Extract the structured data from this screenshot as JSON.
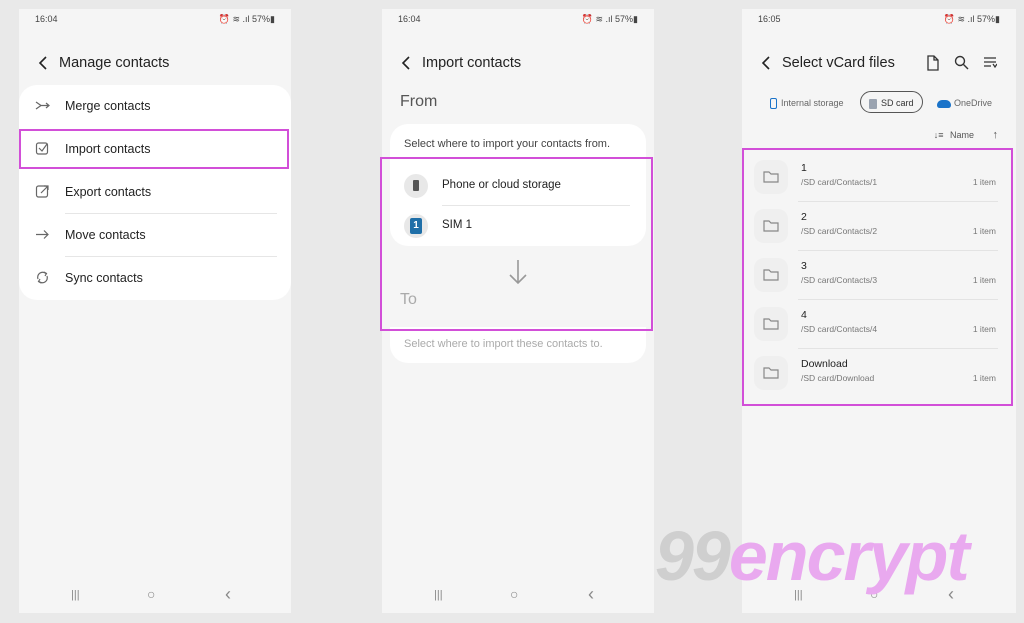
{
  "phone1": {
    "time": "16:04",
    "status_icons": "⏰ ≋ .ıl 57%▮",
    "title": "Manage contacts",
    "items": [
      {
        "label": "Merge contacts",
        "icon": "merge-icon"
      },
      {
        "label": "Import contacts",
        "icon": "import-icon"
      },
      {
        "label": "Export contacts",
        "icon": "export-icon"
      },
      {
        "label": "Move contacts",
        "icon": "move-arrow-icon"
      },
      {
        "label": "Sync contacts",
        "icon": "sync-icon"
      }
    ]
  },
  "phone2": {
    "time": "16:04",
    "status_icons": "⏰ ≋ .ıl 57%▮",
    "title": "Import contacts",
    "from_label": "From",
    "from_caption": "Select where to import your contacts from.",
    "sources": [
      {
        "label": "Phone or cloud storage",
        "icon": "phone-icon"
      },
      {
        "label": "SIM 1",
        "icon": "sim-icon",
        "badge": "1"
      }
    ],
    "to_label": "To",
    "to_caption": "Select where to import these contacts to."
  },
  "phone3": {
    "time": "16:05",
    "status_icons": "⏰ ≋ .ıl 57%▮",
    "title": "Select vCard files",
    "tabs": [
      {
        "label": "Internal storage",
        "selected": false
      },
      {
        "label": "SD card",
        "selected": true
      },
      {
        "label": "OneDrive",
        "selected": false
      }
    ],
    "sort_label": "Name",
    "files": [
      {
        "name": "1",
        "path": "/SD card/Contacts/1",
        "count": "1 item"
      },
      {
        "name": "2",
        "path": "/SD card/Contacts/2",
        "count": "1 item"
      },
      {
        "name": "3",
        "path": "/SD card/Contacts/3",
        "count": "1 item"
      },
      {
        "name": "4",
        "path": "/SD card/Contacts/4",
        "count": "1 item"
      },
      {
        "name": "Download",
        "path": "/SD card/Download",
        "count": "1 item"
      }
    ]
  },
  "nav": {
    "recents": "|||",
    "home": "○",
    "back": "‹"
  },
  "watermark": {
    "part1": "99",
    "part2": "encrypt"
  },
  "colors": {
    "highlight": "#d24fd8",
    "sim_badge": "#1f6fa8",
    "onedrive": "#1a73c9"
  }
}
